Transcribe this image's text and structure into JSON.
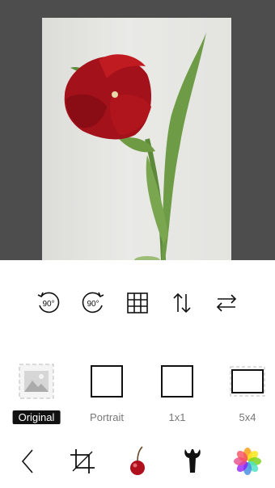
{
  "ratios": {
    "original": "Original",
    "portrait": "Portrait",
    "square": "1x1",
    "five_by_four": "5x4"
  },
  "tools": {
    "rotate_left_degrees": "90°",
    "rotate_right_degrees": "90°"
  },
  "colors": {
    "background": "#ffffff",
    "preview_background": "#4d4d4d",
    "selected_label_background": "#111111"
  },
  "icons": [
    "rotate-left-icon",
    "rotate-right-icon",
    "grid-icon",
    "flip-vertical-icon",
    "flip-horizontal-icon",
    "back-icon",
    "crop-icon",
    "cherry-icon",
    "wrench-icon",
    "photos-icon"
  ]
}
